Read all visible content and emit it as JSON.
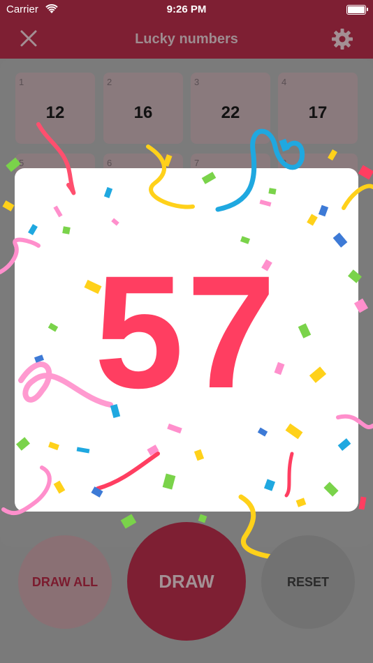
{
  "status_bar": {
    "carrier": "Carrier",
    "time": "9:26 PM"
  },
  "nav": {
    "title": "Lucky numbers",
    "close_icon": "close-icon",
    "settings_icon": "gear-icon"
  },
  "tiles": [
    {
      "index": "1",
      "value": "12"
    },
    {
      "index": "2",
      "value": "16"
    },
    {
      "index": "3",
      "value": "22"
    },
    {
      "index": "4",
      "value": "17"
    },
    {
      "index": "5",
      "value": ""
    },
    {
      "index": "6",
      "value": ""
    },
    {
      "index": "7",
      "value": ""
    },
    {
      "index": "8",
      "value": ""
    }
  ],
  "result": {
    "number": "57"
  },
  "buttons": {
    "draw_all": "DRAW ALL",
    "draw": "DRAW",
    "reset": "RESET"
  },
  "colors": {
    "brand": "#7e1f33",
    "number": "#ff3e61"
  }
}
